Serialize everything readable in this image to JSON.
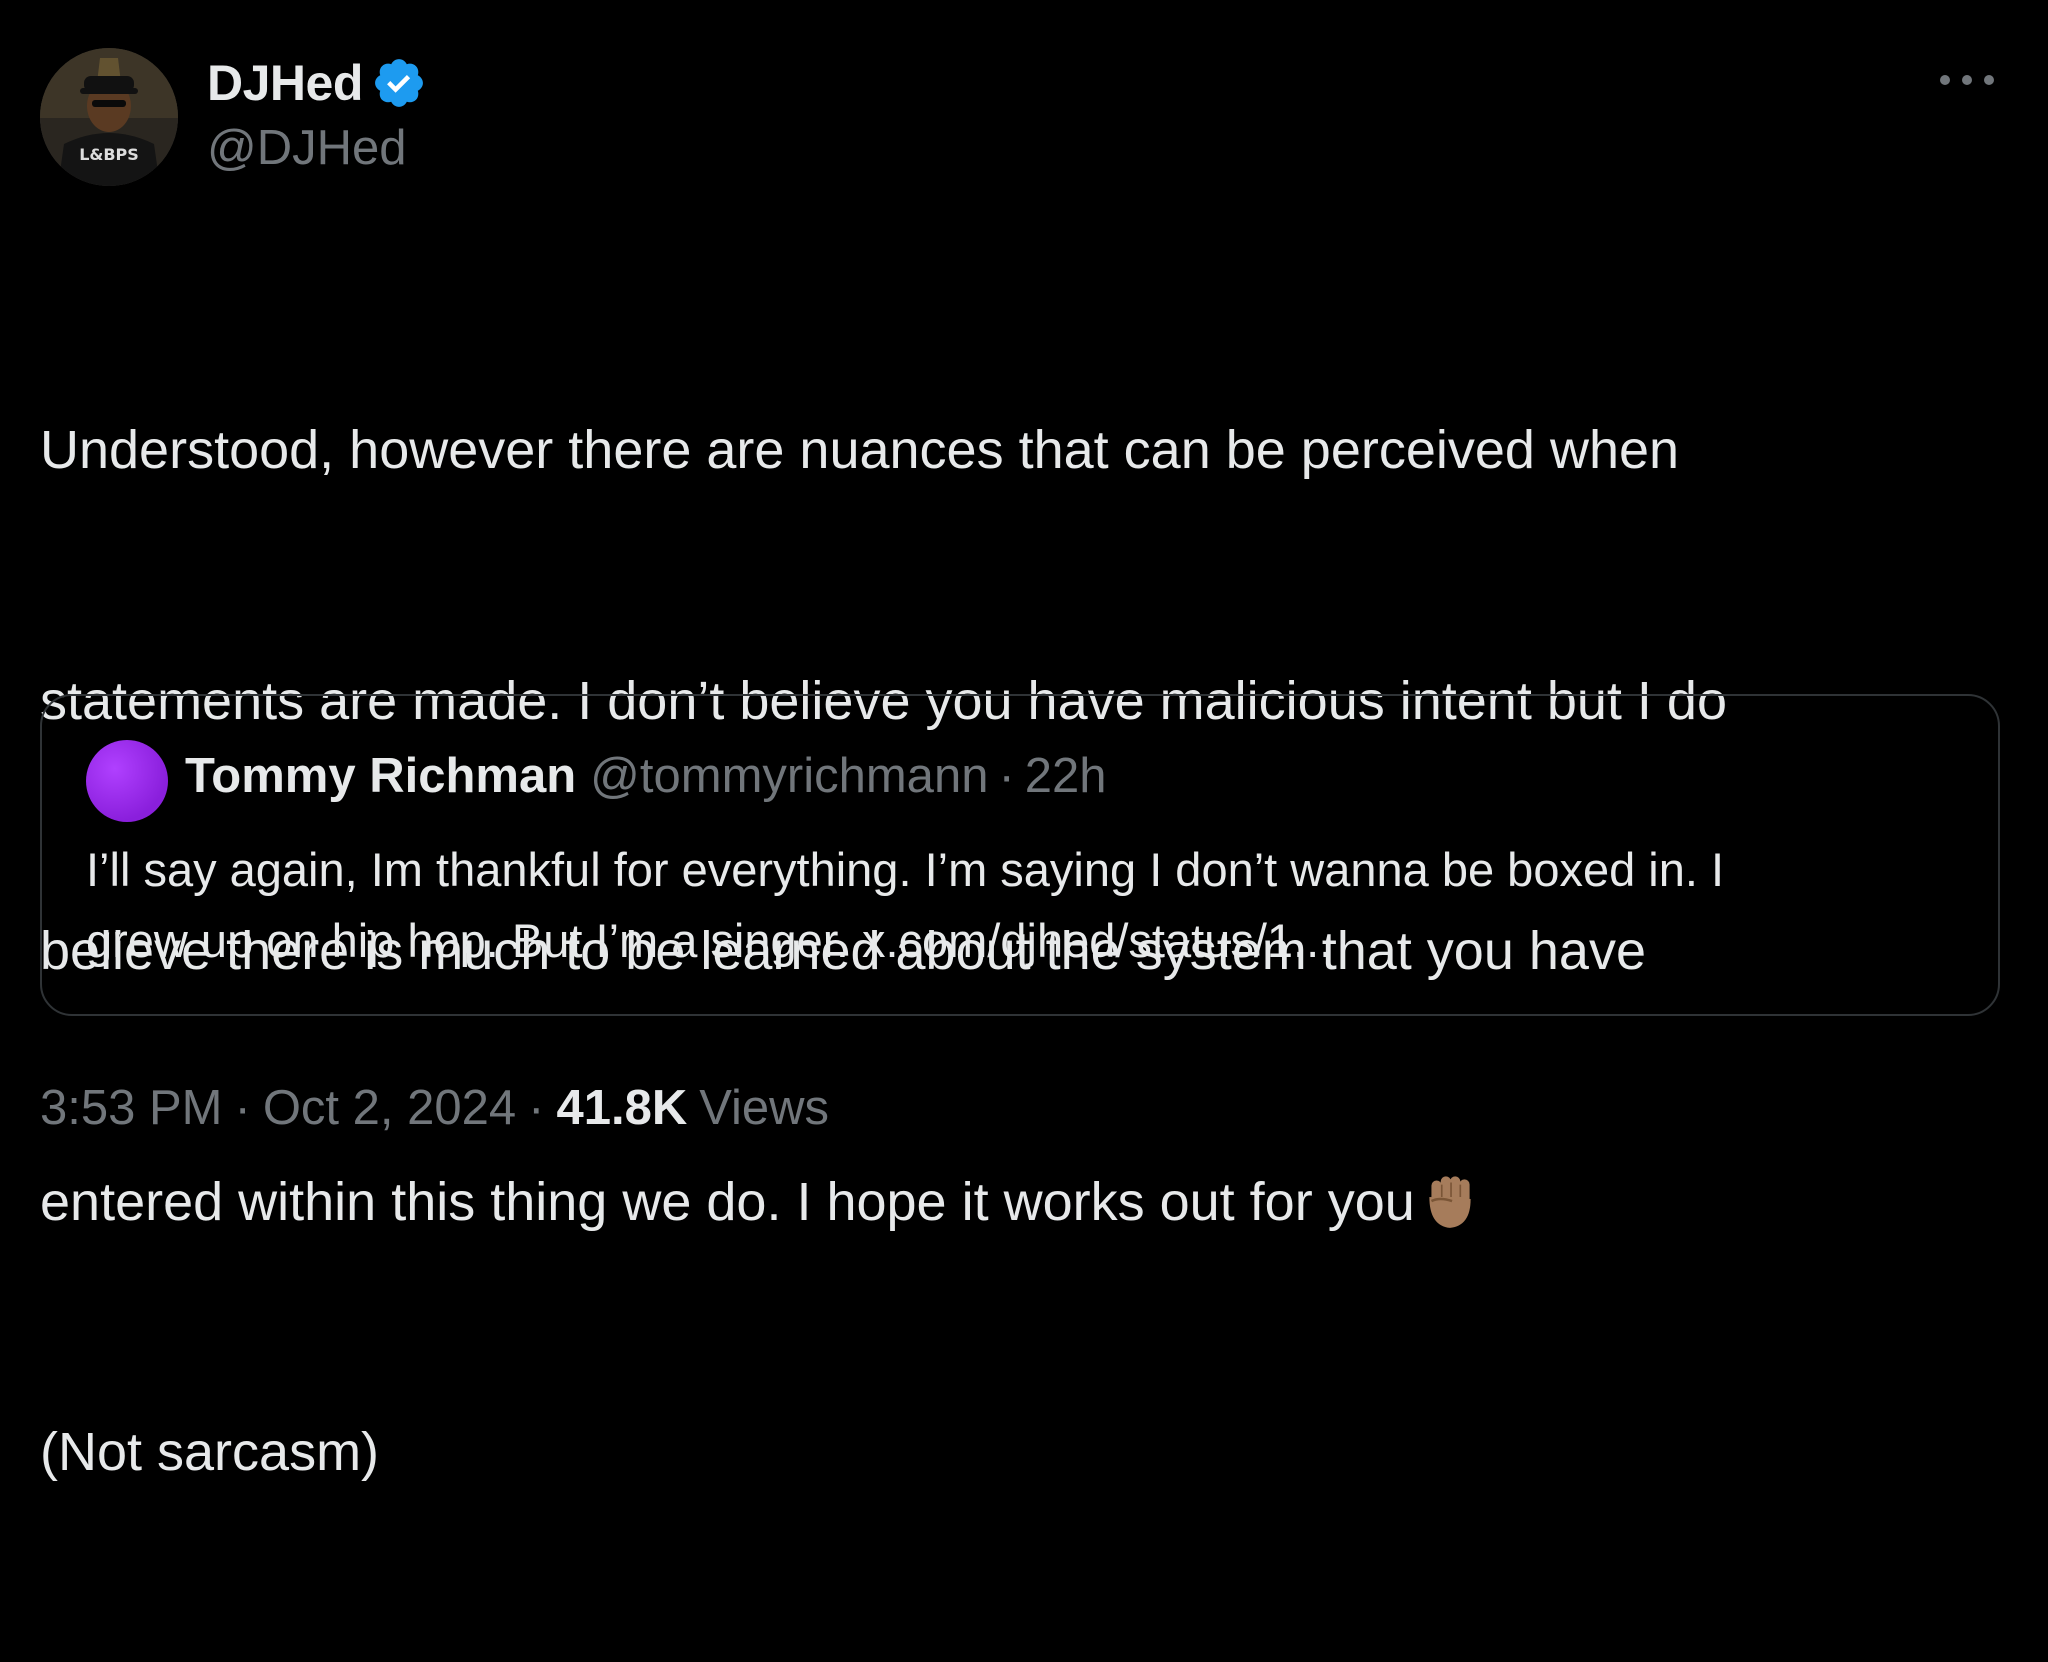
{
  "author": {
    "display_name": "DJHed",
    "handle": "@DJHed",
    "verified": true,
    "avatar_icon": "profile-photo"
  },
  "tweet": {
    "lines": [
      "Understood, however there are nuances that can be perceived when",
      "statements are made. I don’t believe you have malicious intent but I do",
      "believe there is much to be learned about the system that you have",
      "entered within this thing we do. I hope it works out for you",
      "(Not sarcasm)"
    ],
    "emoji": "raised-fist-medium-skin-tone"
  },
  "quoted_tweet": {
    "display_name": "Tommy Richman",
    "handle": "@tommyrichmann",
    "separator": "·",
    "time_ago": "22h",
    "lines": [
      "I’ll say again, Im thankful for everything. I’m saying I don’t wanna be boxed in. I",
      "grew up on hip hop. But I’m a singer. x.com/djhed/status/1..."
    ],
    "avatar_color": "#9b30f0"
  },
  "meta": {
    "time": "3:53 PM",
    "separator": "·",
    "date": "Oct 2, 2024",
    "views_count": "41.8K",
    "views_label": "Views"
  },
  "colors": {
    "background": "#000000",
    "text_primary": "#e7e9ea",
    "text_secondary": "#71767b",
    "verified_blue": "#1d9bf0",
    "border": "#2f3336"
  }
}
